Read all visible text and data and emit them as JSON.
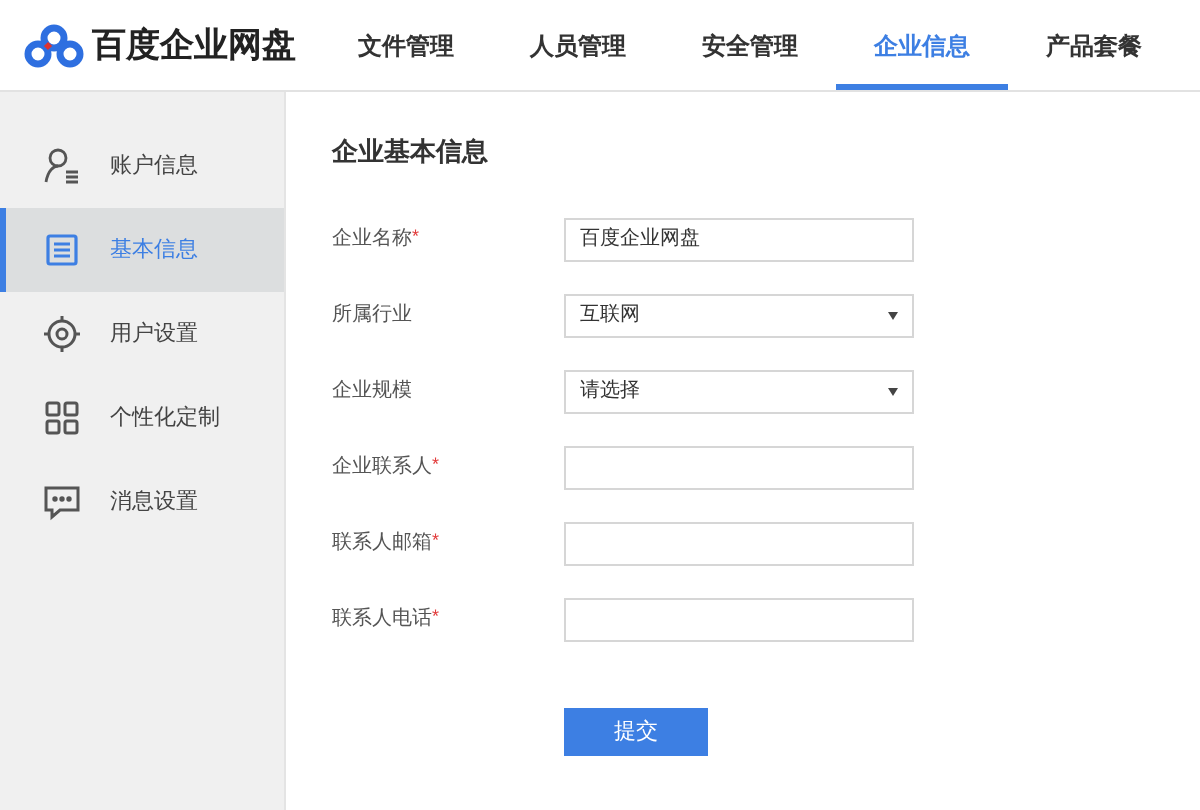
{
  "logo": {
    "text": "百度企业网盘"
  },
  "tabs": [
    {
      "label": "文件管理",
      "selected": false
    },
    {
      "label": "人员管理",
      "selected": false
    },
    {
      "label": "安全管理",
      "selected": false
    },
    {
      "label": "企业信息",
      "selected": true
    },
    {
      "label": "产品套餐",
      "selected": false
    }
  ],
  "sidebar": {
    "items": [
      {
        "kind": "account",
        "label": "账户信息",
        "selected": false
      },
      {
        "kind": "document",
        "label": "基本信息",
        "selected": true
      },
      {
        "kind": "gear",
        "label": "用户设置",
        "selected": false
      },
      {
        "kind": "grid",
        "label": "个性化定制",
        "selected": false
      },
      {
        "kind": "message",
        "label": "消息设置",
        "selected": false
      }
    ]
  },
  "form": {
    "title": "企业基本信息",
    "fields": [
      {
        "kind": "text",
        "label": "企业名称",
        "mark": "*",
        "value": "百度企业网盘"
      },
      {
        "kind": "select",
        "label": "所属行业",
        "value": "互联网"
      },
      {
        "kind": "select",
        "label": "企业规模",
        "value": "请选择"
      },
      {
        "kind": "text",
        "label": "企业联系人",
        "mark": "*"
      },
      {
        "kind": "text",
        "label": "联系人邮箱",
        "mark": "*"
      },
      {
        "kind": "text",
        "label": "联系人电话",
        "mark": "*"
      }
    ],
    "submit": "提交"
  }
}
